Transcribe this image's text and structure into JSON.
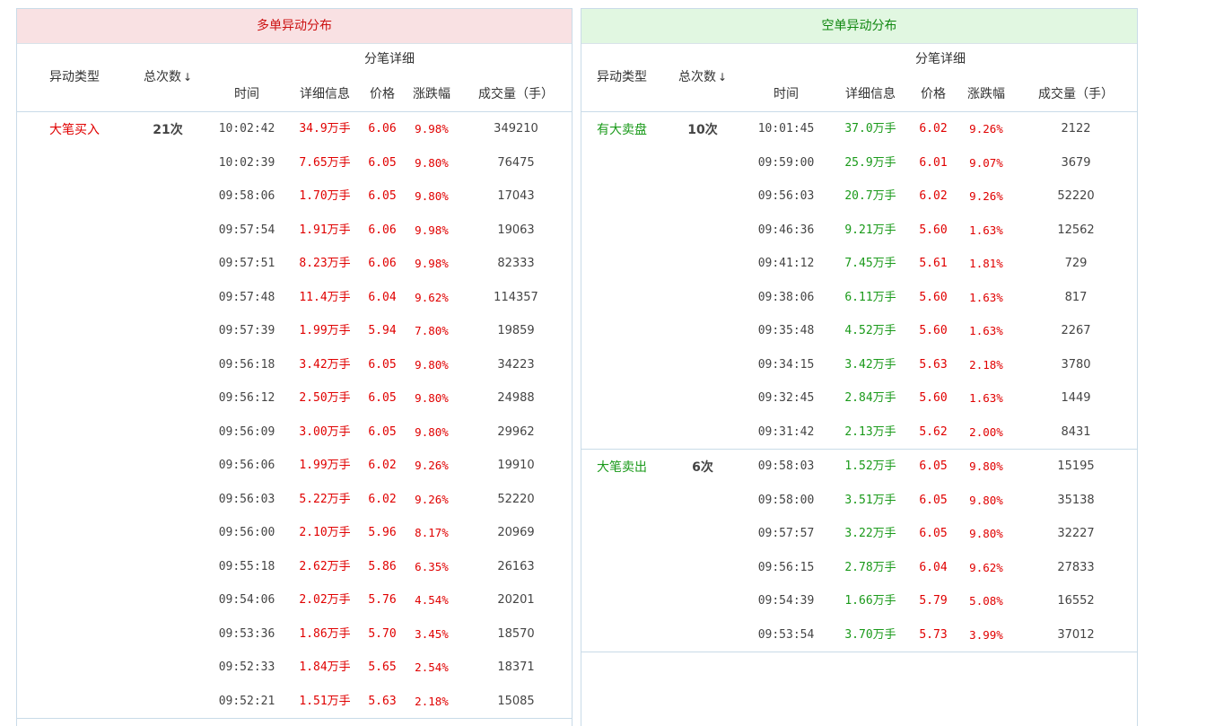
{
  "long_panel": {
    "title": "多单异动分布",
    "headers": {
      "type": "异动类型",
      "count": "总次数",
      "sort_icon": "↓",
      "detail_group": "分笔详细",
      "time": "时间",
      "info": "详细信息",
      "price": "价格",
      "change": "涨跌幅",
      "volume": "成交量（手）"
    },
    "groups": [
      {
        "type": "大笔买入",
        "count": "21次",
        "rows": [
          {
            "time": "10:02:42",
            "info": "34.9万手",
            "price": "6.06",
            "change": "9.98%",
            "volume": "349210"
          },
          {
            "time": "10:02:39",
            "info": "7.65万手",
            "price": "6.05",
            "change": "9.80%",
            "volume": "76475"
          },
          {
            "time": "09:58:06",
            "info": "1.70万手",
            "price": "6.05",
            "change": "9.80%",
            "volume": "17043"
          },
          {
            "time": "09:57:54",
            "info": "1.91万手",
            "price": "6.06",
            "change": "9.98%",
            "volume": "19063"
          },
          {
            "time": "09:57:51",
            "info": "8.23万手",
            "price": "6.06",
            "change": "9.98%",
            "volume": "82333"
          },
          {
            "time": "09:57:48",
            "info": "11.4万手",
            "price": "6.04",
            "change": "9.62%",
            "volume": "114357"
          },
          {
            "time": "09:57:39",
            "info": "1.99万手",
            "price": "5.94",
            "change": "7.80%",
            "volume": "19859"
          },
          {
            "time": "09:56:18",
            "info": "3.42万手",
            "price": "6.05",
            "change": "9.80%",
            "volume": "34223"
          },
          {
            "time": "09:56:12",
            "info": "2.50万手",
            "price": "6.05",
            "change": "9.80%",
            "volume": "24988"
          },
          {
            "time": "09:56:09",
            "info": "3.00万手",
            "price": "6.05",
            "change": "9.80%",
            "volume": "29962"
          },
          {
            "time": "09:56:06",
            "info": "1.99万手",
            "price": "6.02",
            "change": "9.26%",
            "volume": "19910"
          },
          {
            "time": "09:56:03",
            "info": "5.22万手",
            "price": "6.02",
            "change": "9.26%",
            "volume": "52220"
          },
          {
            "time": "09:56:00",
            "info": "2.10万手",
            "price": "5.96",
            "change": "8.17%",
            "volume": "20969"
          },
          {
            "time": "09:55:18",
            "info": "2.62万手",
            "price": "5.86",
            "change": "6.35%",
            "volume": "26163"
          },
          {
            "time": "09:54:06",
            "info": "2.02万手",
            "price": "5.76",
            "change": "4.54%",
            "volume": "20201"
          },
          {
            "time": "09:53:36",
            "info": "1.86万手",
            "price": "5.70",
            "change": "3.45%",
            "volume": "18570"
          },
          {
            "time": "09:52:33",
            "info": "1.84万手",
            "price": "5.65",
            "change": "2.54%",
            "volume": "18371"
          },
          {
            "time": "09:52:21",
            "info": "1.51万手",
            "price": "5.63",
            "change": "2.18%",
            "volume": "15085"
          }
        ]
      }
    ]
  },
  "short_panel": {
    "title": "空单异动分布",
    "headers": {
      "type": "异动类型",
      "count": "总次数",
      "sort_icon": "↓",
      "detail_group": "分笔详细",
      "time": "时间",
      "info": "详细信息",
      "price": "价格",
      "change": "涨跌幅",
      "volume": "成交量（手）"
    },
    "groups": [
      {
        "type": "有大卖盘",
        "count": "10次",
        "rows": [
          {
            "time": "10:01:45",
            "info": "37.0万手",
            "price": "6.02",
            "change": "9.26%",
            "volume": "2122"
          },
          {
            "time": "09:59:00",
            "info": "25.9万手",
            "price": "6.01",
            "change": "9.07%",
            "volume": "3679"
          },
          {
            "time": "09:56:03",
            "info": "20.7万手",
            "price": "6.02",
            "change": "9.26%",
            "volume": "52220"
          },
          {
            "time": "09:46:36",
            "info": "9.21万手",
            "price": "5.60",
            "change": "1.63%",
            "volume": "12562"
          },
          {
            "time": "09:41:12",
            "info": "7.45万手",
            "price": "5.61",
            "change": "1.81%",
            "volume": "729"
          },
          {
            "time": "09:38:06",
            "info": "6.11万手",
            "price": "5.60",
            "change": "1.63%",
            "volume": "817"
          },
          {
            "time": "09:35:48",
            "info": "4.52万手",
            "price": "5.60",
            "change": "1.63%",
            "volume": "2267"
          },
          {
            "time": "09:34:15",
            "info": "3.42万手",
            "price": "5.63",
            "change": "2.18%",
            "volume": "3780"
          },
          {
            "time": "09:32:45",
            "info": "2.84万手",
            "price": "5.60",
            "change": "1.63%",
            "volume": "1449"
          },
          {
            "time": "09:31:42",
            "info": "2.13万手",
            "price": "5.62",
            "change": "2.00%",
            "volume": "8431"
          }
        ]
      },
      {
        "type": "大笔卖出",
        "count": "6次",
        "rows": [
          {
            "time": "09:58:03",
            "info": "1.52万手",
            "price": "6.05",
            "change": "9.80%",
            "volume": "15195"
          },
          {
            "time": "09:58:00",
            "info": "3.51万手",
            "price": "6.05",
            "change": "9.80%",
            "volume": "35138"
          },
          {
            "time": "09:57:57",
            "info": "3.22万手",
            "price": "6.05",
            "change": "9.80%",
            "volume": "32227"
          },
          {
            "time": "09:56:15",
            "info": "2.78万手",
            "price": "6.04",
            "change": "9.62%",
            "volume": "27833"
          },
          {
            "time": "09:54:39",
            "info": "1.66万手",
            "price": "5.79",
            "change": "5.08%",
            "volume": "16552"
          },
          {
            "time": "09:53:54",
            "info": "3.70万手",
            "price": "5.73",
            "change": "3.99%",
            "volume": "37012"
          }
        ]
      }
    ]
  },
  "colors": {
    "up": "#e00000",
    "down": "#1a9a1a",
    "long_header_bg": "#f9e1e3",
    "short_header_bg": "#e1f7e1",
    "border": "#c9dbe8"
  }
}
